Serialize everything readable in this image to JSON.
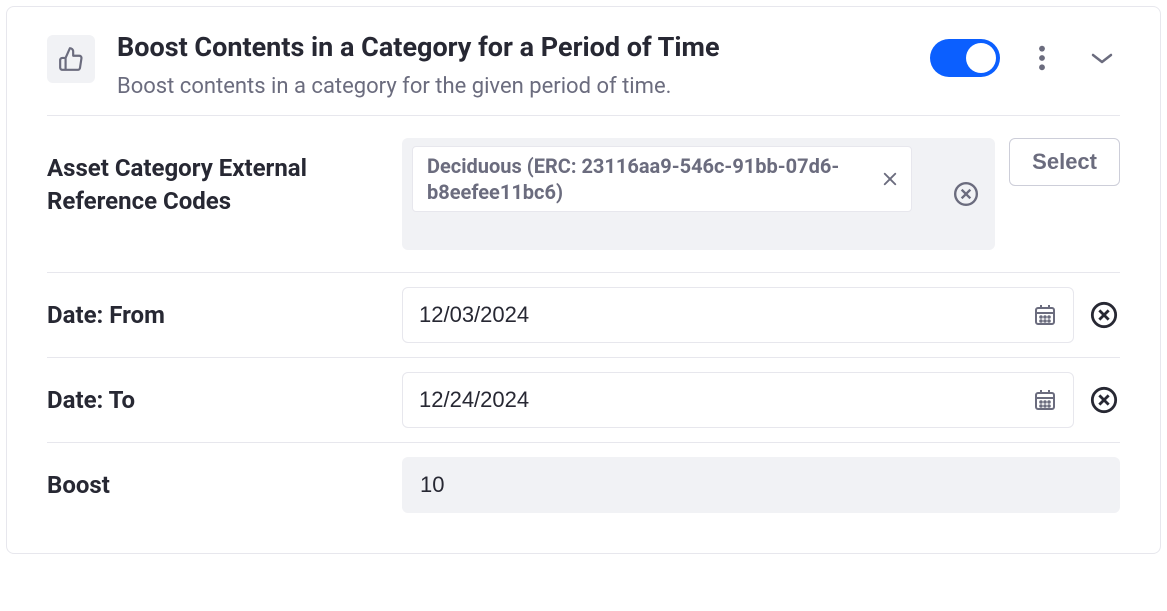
{
  "header": {
    "title": "Boost Contents in a Category for a Period of Time",
    "subtitle": "Boost contents in a category for the given period of time."
  },
  "toggle": {
    "enabled": true
  },
  "fields": {
    "asset_category": {
      "label": "Asset Category External Reference Codes",
      "chip": "Deciduous (ERC: 23116aa9-546c-91bb-07d6-b8eefee11bc6)",
      "select_label": "Select"
    },
    "date_from": {
      "label": "Date: From",
      "value": "12/03/2024"
    },
    "date_to": {
      "label": "Date: To",
      "value": "12/24/2024"
    },
    "boost": {
      "label": "Boost",
      "value": "10"
    }
  }
}
